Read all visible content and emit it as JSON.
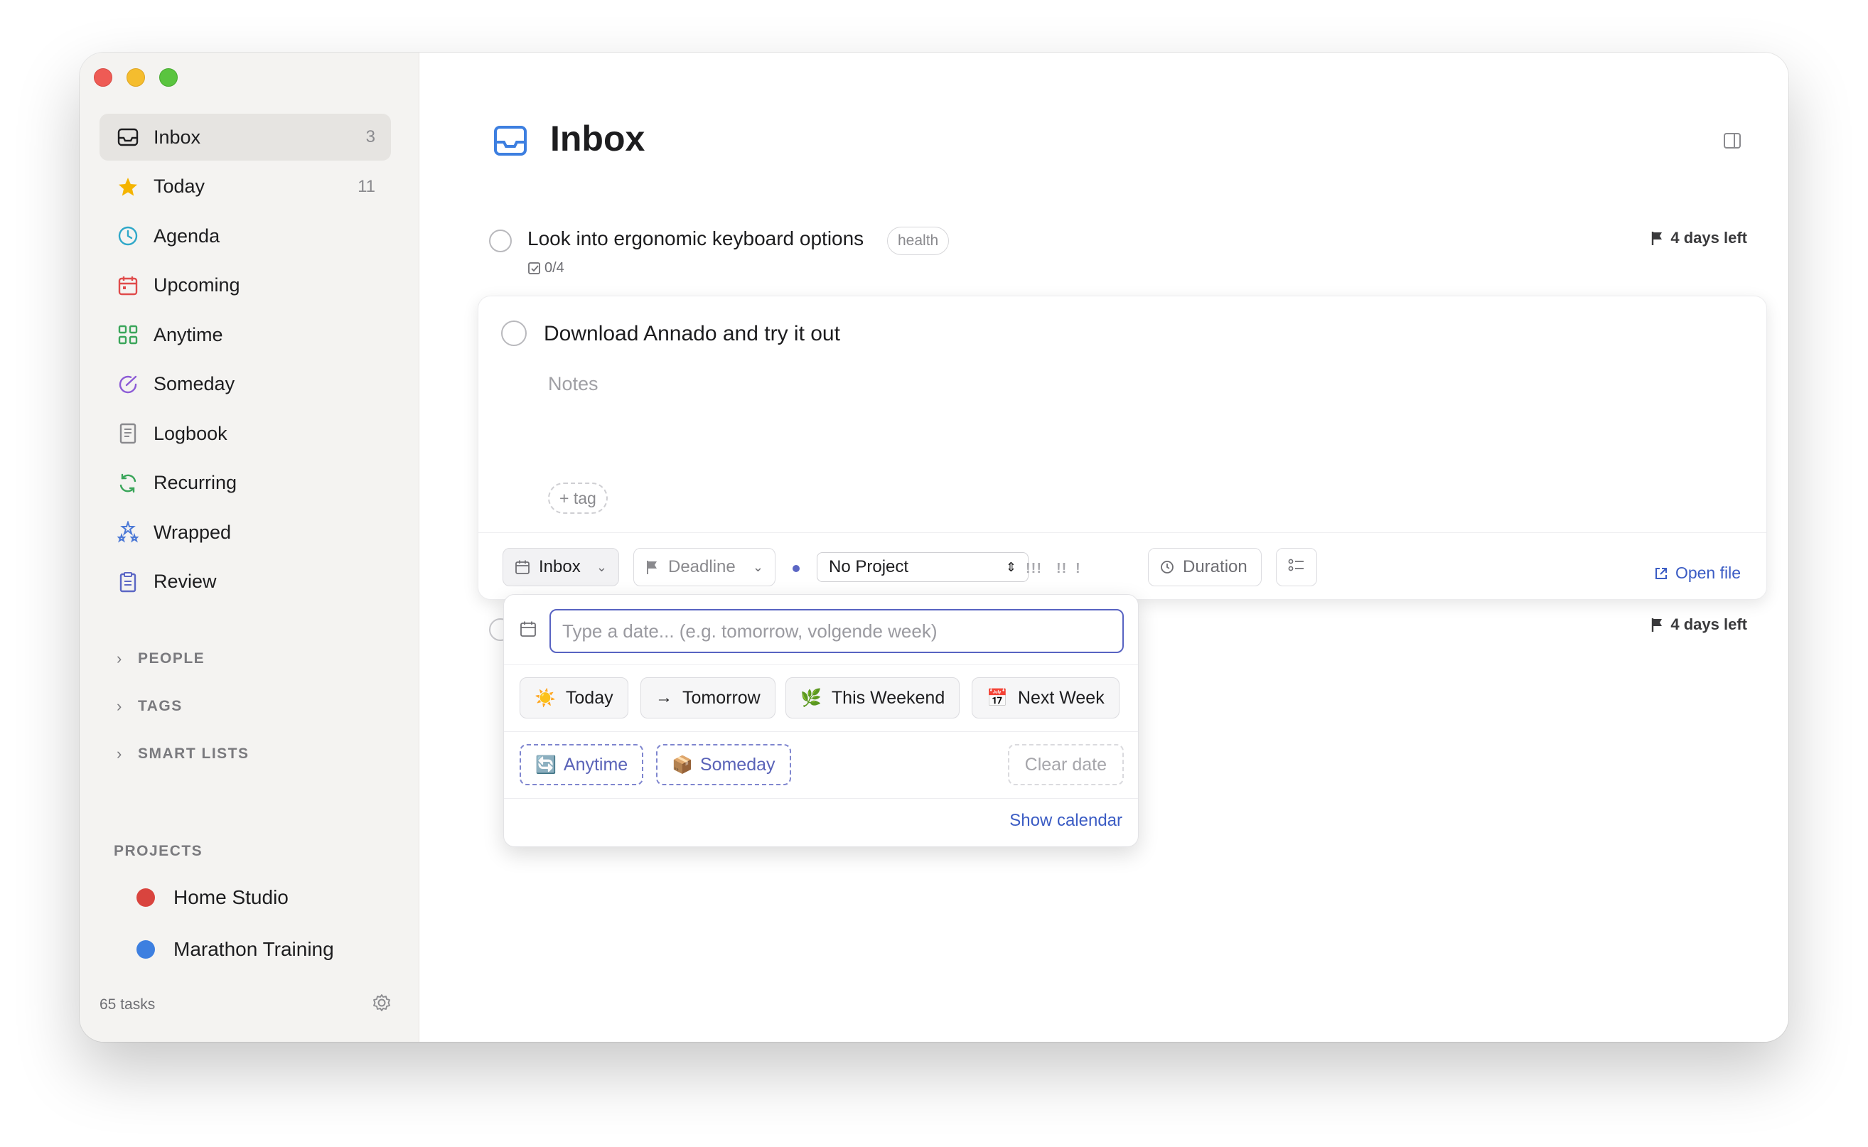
{
  "sidebar": {
    "nav": [
      {
        "label": "Inbox",
        "count": "3",
        "icon": "inbox-icon",
        "color": "#1d1d1f"
      },
      {
        "label": "Today",
        "count": "11",
        "icon": "star-icon",
        "color": "#f4b400"
      },
      {
        "label": "Agenda",
        "count": "",
        "icon": "clock-icon",
        "color": "#2fa8c9"
      },
      {
        "label": "Upcoming",
        "count": "",
        "icon": "calendar-icon",
        "color": "#e04b4b"
      },
      {
        "label": "Anytime",
        "count": "",
        "icon": "grid-icon",
        "color": "#3aa55a"
      },
      {
        "label": "Someday",
        "count": "",
        "icon": "someday-icon",
        "color": "#8c5bd6"
      },
      {
        "label": "Logbook",
        "count": "",
        "icon": "book-icon",
        "color": "#8a8a8e"
      },
      {
        "label": "Recurring",
        "count": "",
        "icon": "recurring-icon",
        "color": "#3aa55a"
      },
      {
        "label": "Wrapped",
        "count": "",
        "icon": "stars-icon",
        "color": "#4a78d6"
      },
      {
        "label": "Review",
        "count": "",
        "icon": "clipboard-icon",
        "color": "#5b66c4"
      }
    ],
    "sections": {
      "people": "PEOPLE",
      "tags": "TAGS",
      "smart_lists": "SMART LISTS"
    },
    "projects_header": "PROJECTS",
    "projects": [
      {
        "name": "Home Studio",
        "color": "#d9443e"
      },
      {
        "name": "Marathon Training",
        "color": "#3d7fe0"
      }
    ],
    "footer_count": "65 tasks"
  },
  "main": {
    "title": "Inbox",
    "tasks": [
      {
        "title": "Look into ergonomic keyboard options",
        "tag": "health",
        "subtasks": "0/4",
        "deadline": "4 days left"
      }
    ],
    "editing_task": {
      "title": "Download Annado and try it out",
      "notes_placeholder": "Notes",
      "tag_button": "+ tag"
    },
    "toolbar": {
      "when": "Inbox",
      "deadline": "Deadline",
      "project": "No Project",
      "priority_high": "!!!",
      "priority_medium": "!!",
      "priority_low": "!",
      "duration": "Duration",
      "open_file": "Open file"
    },
    "third_task_deadline": "4 days left"
  },
  "date_picker": {
    "placeholder": "Type a date... (e.g. tomorrow, volgende week)",
    "quick": [
      {
        "label": "Today",
        "emoji": "☀️"
      },
      {
        "label": "Tomorrow",
        "emoji": "→"
      },
      {
        "label": "This Weekend",
        "emoji": "🌿"
      },
      {
        "label": "Next Week",
        "emoji": "📅"
      }
    ],
    "anytime": {
      "label": "Anytime",
      "emoji": "🔄"
    },
    "someday": {
      "label": "Someday",
      "emoji": "📦"
    },
    "clear": "Clear date",
    "show_calendar": "Show calendar"
  },
  "colors": {
    "accent": "#5863c2",
    "link": "#3b5cc4"
  }
}
